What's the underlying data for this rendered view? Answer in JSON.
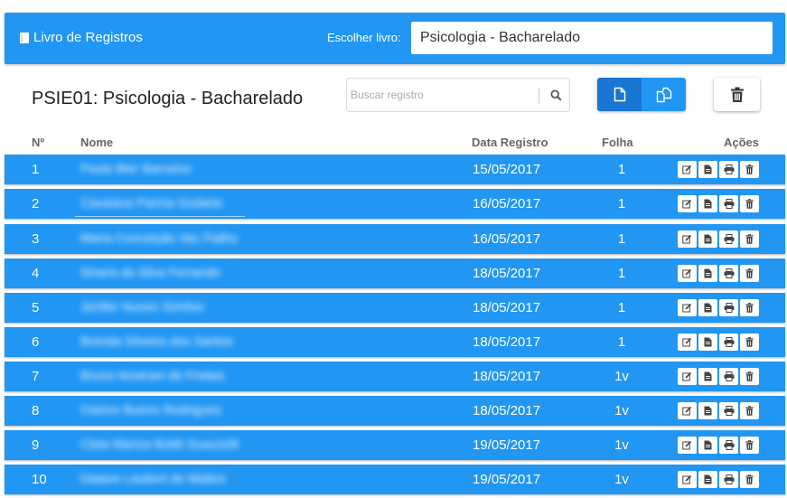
{
  "header": {
    "brand": "Livro de Registros",
    "choose_label": "Escolher livro:",
    "selected_book": "Psicologia - Bacharelado"
  },
  "page": {
    "title": "PSIE01: Psicologia - Bacharelado",
    "search_placeholder": "Buscar registro"
  },
  "table": {
    "columns": {
      "num": "Nº",
      "name": "Nome",
      "date": "Data Registro",
      "folha": "Folha",
      "actions": "Ações"
    },
    "rows": [
      {
        "num": "1",
        "name": "Paulo Bier Barcelos",
        "date": "15/05/2017",
        "folha": "1"
      },
      {
        "num": "2",
        "name": "Cassiana Parma Godarte",
        "date": "16/05/2017",
        "folha": "1"
      },
      {
        "num": "3",
        "name": "Maria Conceição Vaz Fialho",
        "date": "16/05/2017",
        "folha": "1"
      },
      {
        "num": "4",
        "name": "Sinara da Silva Ferrando",
        "date": "18/05/2017",
        "folha": "1"
      },
      {
        "num": "5",
        "name": "Jenifer Nunes Simões",
        "date": "18/05/2017",
        "folha": "1"
      },
      {
        "num": "6",
        "name": "Brenda Silveira dos Santos",
        "date": "18/05/2017",
        "folha": "1"
      },
      {
        "num": "7",
        "name": "Bruna Nostrani de Freitas",
        "date": "18/05/2017",
        "folha": "1v"
      },
      {
        "num": "8",
        "name": "Clarice Bueno Rodrigues",
        "date": "18/05/2017",
        "folha": "1v"
      },
      {
        "num": "9",
        "name": "Cleia Mariza Boldt Guazzelli",
        "date": "19/05/2017",
        "folha": "1v"
      },
      {
        "num": "10",
        "name": "Daiane Laubert de Mattos",
        "date": "19/05/2017",
        "folha": "1v"
      }
    ]
  },
  "colors": {
    "primary": "#2196f3",
    "primary_dark": "#1976d2",
    "white": "#ffffff"
  },
  "icons": {
    "brand": "book-icon",
    "search": "search-icon",
    "view_single": "file-icon",
    "view_multi": "copy-icon",
    "trash": "trash-icon",
    "row_actions": [
      "edit-icon",
      "document-icon",
      "print-icon",
      "trash-icon"
    ]
  }
}
